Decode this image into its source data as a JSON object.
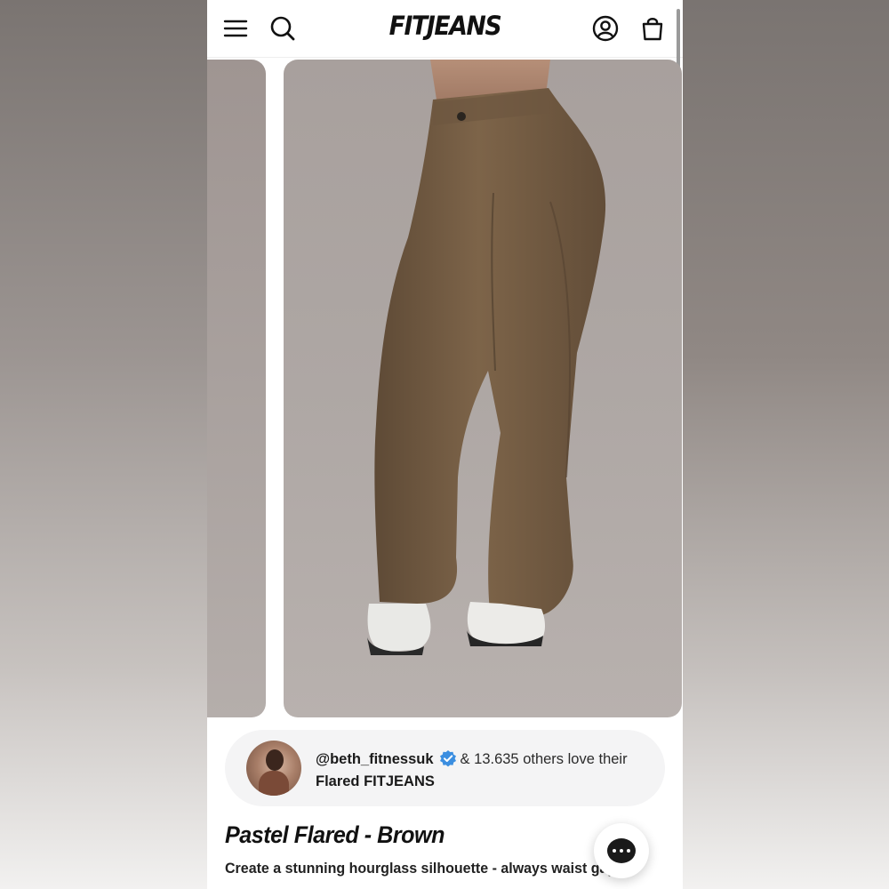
{
  "header": {
    "brand": "FITJEANS",
    "icons": [
      "menu-icon",
      "search-icon",
      "account-icon",
      "cart-icon"
    ]
  },
  "gallery": {
    "main_image_alt": "Brown pastel flared jeans worn with white sneakers",
    "colors": {
      "jeans": "#7a6248",
      "background": "#aea7a4"
    }
  },
  "social_proof": {
    "handle": "@beth_fitnessuk",
    "love_text": "& 13.635 others love their",
    "product_text": "Flared FITJEANS",
    "verified_color": "#3b8ee0"
  },
  "product": {
    "title": "Pastel Flared - Brown",
    "subtitle": "Create a stunning hourglass silhouette - always waist gap proof"
  },
  "chat": {
    "icon": "chat-icon"
  }
}
